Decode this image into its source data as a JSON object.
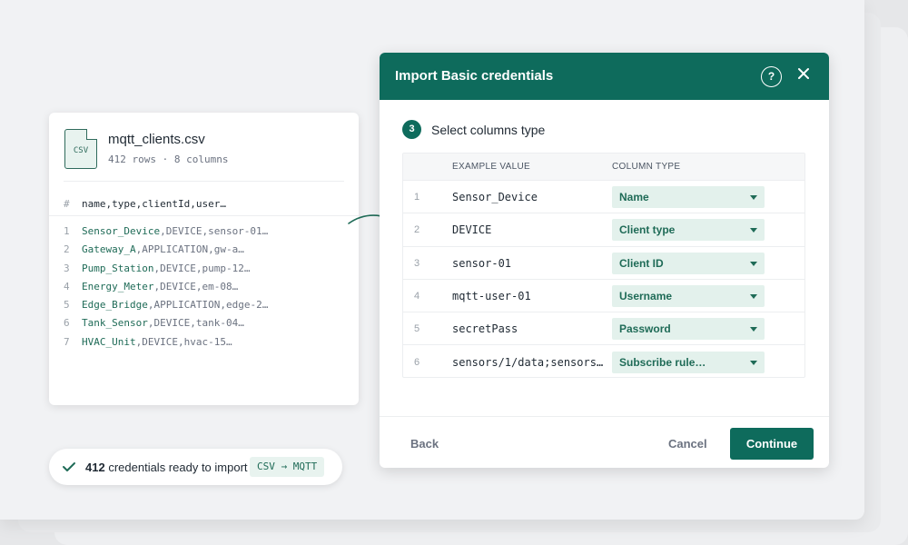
{
  "file": {
    "icon": "csv-file-icon",
    "icon_label": "CSV",
    "name": "mqtt_clients.csv",
    "meta": "412 rows · 8 columns",
    "header_symbol": "#",
    "header_columns": "name,type,clientId,user…",
    "lines": [
      {
        "num": "1",
        "key": "Sensor_Device",
        "rest": ",DEVICE,sensor-01…"
      },
      {
        "num": "2",
        "key": "Gateway_A",
        "rest": ",APPLICATION,gw-a…"
      },
      {
        "num": "3",
        "key": "Pump_Station",
        "rest": ",DEVICE,pump-12…"
      },
      {
        "num": "4",
        "key": "Energy_Meter",
        "rest": ",DEVICE,em-08…"
      },
      {
        "num": "5",
        "key": "Edge_Bridge",
        "rest": ",APPLICATION,edge-2…"
      },
      {
        "num": "6",
        "key": "Tank_Sensor",
        "rest": ",DEVICE,tank-04…"
      },
      {
        "num": "7",
        "key": "HVAC_Unit",
        "rest": ",DEVICE,hvac-15…"
      }
    ]
  },
  "status": {
    "icon": "check-icon",
    "count": "412",
    "text": "credentials ready to import",
    "badge": "CSV → MQTT"
  },
  "dialog": {
    "title": "Import Basic credentials",
    "help_label": "?",
    "step": {
      "number": "3",
      "title": "Select columns type"
    },
    "table": {
      "headers": {
        "example": "EXAMPLE VALUE",
        "type": "COLUMN TYPE"
      },
      "rows": [
        {
          "num": "1",
          "example": "Sensor_Device",
          "type": "Name"
        },
        {
          "num": "2",
          "example": "DEVICE",
          "type": "Client type"
        },
        {
          "num": "3",
          "example": "sensor-01",
          "type": "Client ID"
        },
        {
          "num": "4",
          "example": "mqtt-user-01",
          "type": "Username"
        },
        {
          "num": "5",
          "example": "secretPass",
          "type": "Password"
        },
        {
          "num": "6",
          "example": "sensors/1/data;sensors…",
          "type": "Subscribe rule…"
        }
      ]
    },
    "footer": {
      "back": "Back",
      "cancel": "Cancel",
      "continue": "Continue"
    }
  },
  "colors": {
    "brand": "#0e6b5c",
    "accent_bg": "#e3f1ec",
    "accent_text": "#1f6b57"
  }
}
